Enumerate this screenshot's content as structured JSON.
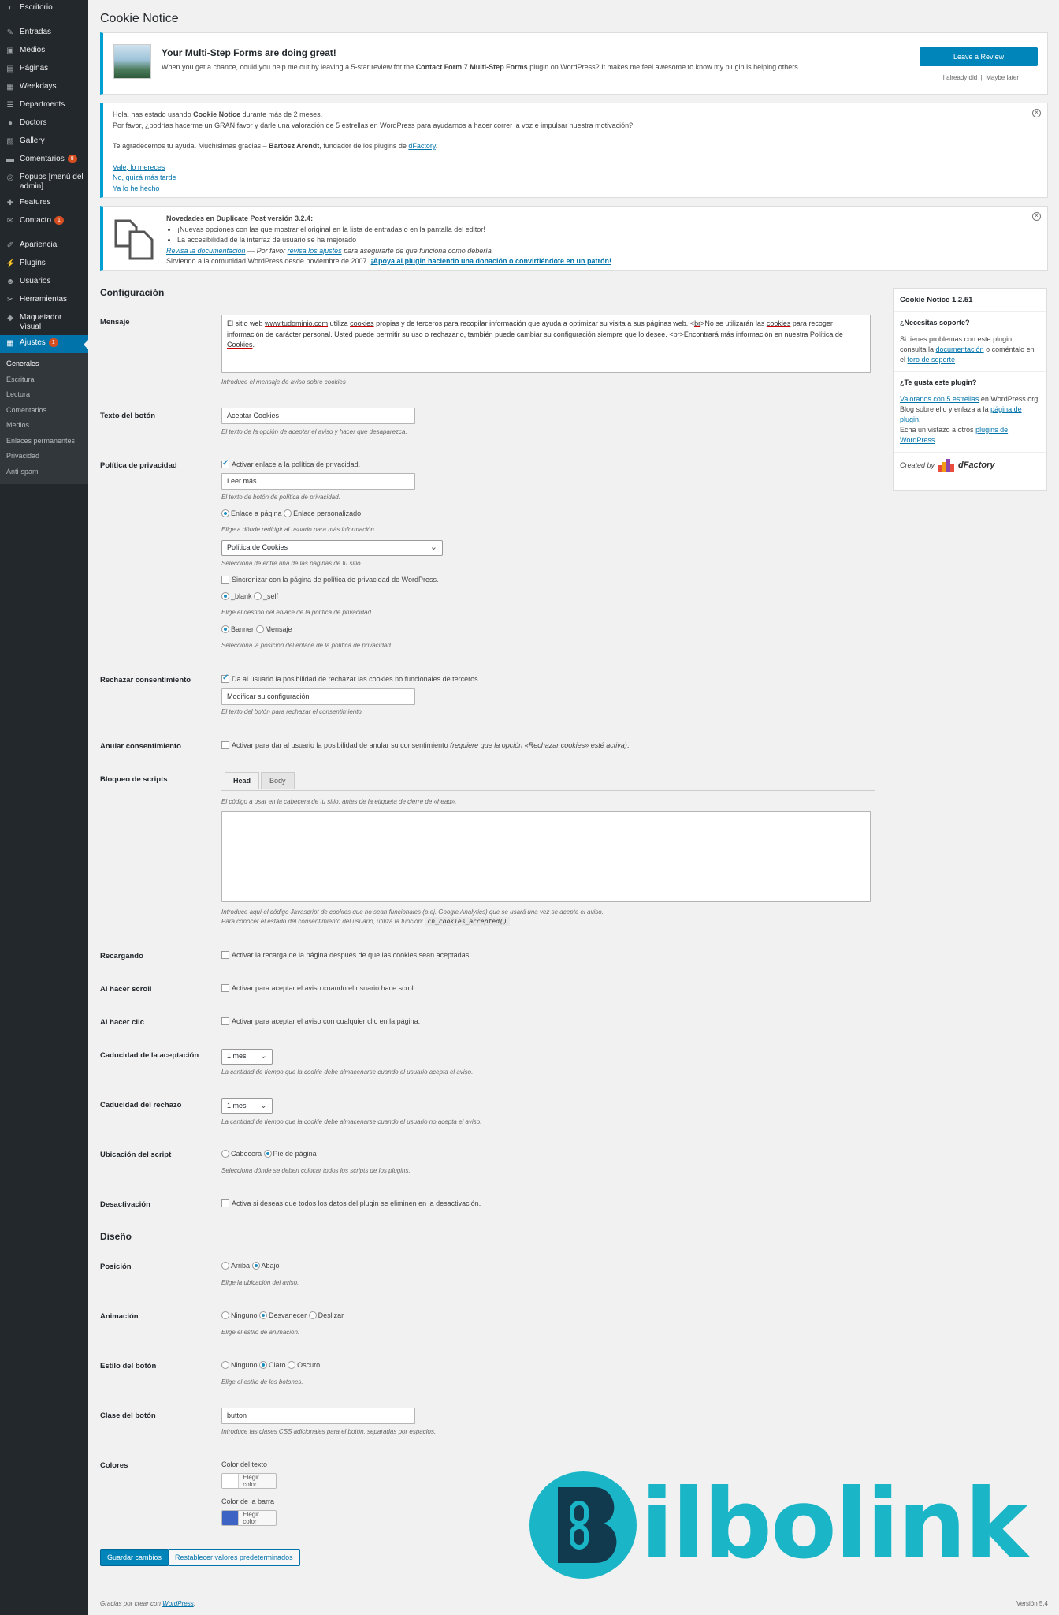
{
  "sidebar": {
    "items": [
      {
        "label": "Escritorio",
        "icon": "dashboard-icon"
      },
      {
        "label": "Entradas",
        "icon": "pin-icon"
      },
      {
        "label": "Medios",
        "icon": "media-icon"
      },
      {
        "label": "Páginas",
        "icon": "pages-icon"
      },
      {
        "label": "Weekdays",
        "icon": "calendar-icon"
      },
      {
        "label": "Departments",
        "icon": "list-icon"
      },
      {
        "label": "Doctors",
        "icon": "user-icon"
      },
      {
        "label": "Gallery",
        "icon": "gallery-icon"
      },
      {
        "label": "Comentarios",
        "icon": "comment-icon",
        "badge": "8"
      },
      {
        "label": "Popups [menú del admin]",
        "icon": "popup-icon"
      },
      {
        "label": "Features",
        "icon": "features-icon"
      },
      {
        "label": "Contacto",
        "icon": "mail-icon",
        "badge": "1"
      },
      {
        "label": "Apariencia",
        "icon": "brush-icon"
      },
      {
        "label": "Plugins",
        "icon": "plugin-icon"
      },
      {
        "label": "Usuarios",
        "icon": "users-icon"
      },
      {
        "label": "Herramientas",
        "icon": "wrench-icon"
      },
      {
        "label": "Maquetador Visual",
        "icon": "divi-icon"
      },
      {
        "label": "Ajustes",
        "icon": "settings-icon",
        "badge": "1"
      }
    ],
    "submenu": [
      "Generales",
      "Escritura",
      "Lectura",
      "Comentarios",
      "Medios",
      "Enlaces permanentes",
      "Privacidad",
      "Anti-spam"
    ]
  },
  "page_title": "Cookie Notice",
  "notice1": {
    "title": "Your Multi-Step Forms are doing great!",
    "text_a": "When you get a chance, could you help me out by leaving a 5-star review for the ",
    "text_b": "Contact Form 7 Multi-Step Forms",
    "text_c": " plugin on WordPress? It makes me feel awesome to know my plugin is helping others.",
    "button": "Leave a Review",
    "link1": "I already did",
    "divider": "|",
    "link2": "Maybe later"
  },
  "notice2": {
    "l1a": "Hola, has estado usando ",
    "l1b": "Cookie Notice",
    "l1c": " durante más de 2 meses.",
    "l2": "Por favor, ¿podrías hacerme un GRAN favor y darle una valoración de 5 estrellas en WordPress para ayudarnos a hacer correr la voz e impulsar nuestra motivación?",
    "l3a": "Te agradecemos tu ayuda. Muchísimas gracias – ",
    "l3b": "Bartosz Arendt",
    "l3c": ", fundador de los plugins de ",
    "l3d": "dFactory",
    "l3e": ".",
    "links": [
      "Vale, lo mereces",
      "No, quizá más tarde",
      "Ya lo he hecho"
    ]
  },
  "notice3": {
    "title": "Novedades en Duplicate Post versión 3.2.4:",
    "bullets": [
      "¡Nuevas opciones con las que mostrar el original en la lista de entradas o en la pantalla del editor!",
      "La accesibilidad de la interfaz de usuario se ha mejorado"
    ],
    "l3a": "Revisa la documentación",
    "l3b": " — Por favor ",
    "l3c": "revisa los ajustes",
    "l3d": " para asegurarte de que funciona como debería.",
    "l4a": "Sirviendo a la comunidad WordPress desde noviembre de 2007. ",
    "l4b": "¡Apoya al plugin haciendo una donación o convirtiéndote en un patrón!"
  },
  "config": {
    "heading": "Configuración",
    "mensaje": {
      "label": "Mensaje",
      "t1": "El sitio web ",
      "t2": "www.tudominio.com",
      "t3": " utiliza ",
      "t4": "cookies",
      "t5": " propias y de terceros para recopilar información que ayuda a optimizar su visita a sus páginas web. <",
      "t6": "br",
      "t7": ">No se utilizarán las ",
      "t8": "cookies",
      "t9": " para recoger información de carácter personal. Usted puede permitir su uso o rechazarlo, también puede cambiar su configuración siempre que lo desee. <",
      "t10": "br",
      "t11": ">Encontrará más información en nuestra Política de ",
      "t12": "Cookies",
      "t13": ".",
      "desc": "Introduce el mensaje de aviso sobre cookies"
    },
    "boton": {
      "label": "Texto del botón",
      "value": "Aceptar Cookies",
      "desc": "El texto de la opción de aceptar el aviso y hacer que desaparezca."
    },
    "privacidad": {
      "label": "Política de privacidad",
      "check": "Activar enlace a la política de privacidad.",
      "value": "Leer más",
      "desc1": "El texto de botón de política de privacidad.",
      "r1a": "Enlace a página",
      "r1b": "Enlace personalizado",
      "desc2": "Elige a dónde redirigir al usuario para más información.",
      "select": "Política de Cookies",
      "desc3": "Selecciona de entre una de las páginas de tu sitio",
      "sync": "Sincronizar con la página de política de privacidad de WordPress.",
      "r2a": "_blank",
      "r2b": "_self",
      "desc4": "Elige el destino del enlace de la política de privacidad.",
      "r3a": "Banner",
      "r3b": "Mensaje",
      "desc5": "Selecciona la posición del enlace de la política de privacidad."
    },
    "rechazar": {
      "label": "Rechazar consentimiento",
      "check": "Da al usuario la posibilidad de rechazar las cookies no funcionales de terceros.",
      "value": "Modificar su configuración",
      "desc": "El texto del botón para rechazar el consentimiento."
    },
    "anular": {
      "label": "Anular consentimiento",
      "check": "Activar para dar al usuario la posibilidad de anular su consentimiento ",
      "check_em": "(requiere que la opción «Rechazar cookies» esté activa)",
      "check_end": "."
    },
    "bloqueo": {
      "label": "Bloqueo de scripts",
      "tab1": "Head",
      "tab2": "Body",
      "desc1": "El código a usar en la cabecera de tu sitio, antes de la etiqueta de cierre de «head».",
      "desc2": "Introduce aquí el código Javascript de cookies que no sean funcionales (p.ej. Google Analytics) que se usará una vez se acepte el aviso.",
      "desc3": "Para conocer el estado del consentimiento del usuario, utiliza la función: ",
      "code": "cn_cookies_accepted()"
    },
    "recargando": {
      "label": "Recargando",
      "check": "Activar la recarga de la página después de que las cookies sean aceptadas."
    },
    "scroll": {
      "label": "Al hacer scroll",
      "check": "Activar para aceptar el aviso cuando el usuario hace scroll."
    },
    "clic": {
      "label": "Al hacer clic",
      "check": "Activar para aceptar el aviso con cualquier clic en la página."
    },
    "caducidad_acept": {
      "label": "Caducidad de la aceptación",
      "value": "1 mes",
      "desc": "La cantidad de tiempo que la cookie debe almacenarse cuando el usuario acepta el aviso."
    },
    "caducidad_rech": {
      "label": "Caducidad del rechazo",
      "value": "1 mes",
      "desc": "La cantidad de tiempo que la cookie debe almacenarse cuando el usuario no acepta el aviso."
    },
    "ubicacion": {
      "label": "Ubicación del script",
      "r1": "Cabecera",
      "r2": "Pie de página",
      "desc": "Selecciona dónde se deben colocar todos los scripts de los plugins."
    },
    "desactivacion": {
      "label": "Desactivación",
      "check": "Activa si deseas que todos los datos del plugin se eliminen en la desactivación."
    }
  },
  "diseno": {
    "heading": "Diseño",
    "posicion": {
      "label": "Posición",
      "r1": "Arriba",
      "r2": "Abajo",
      "desc": "Elige la ubicación del aviso."
    },
    "animacion": {
      "label": "Animación",
      "r1": "Ninguno",
      "r2": "Desvanecer",
      "r3": "Deslizar",
      "desc": "Elige el estilo de animación."
    },
    "estilo": {
      "label": "Estilo del botón",
      "r1": "Ninguno",
      "r2": "Claro",
      "r3": "Oscuro",
      "desc": "Elige el estilo de los botones."
    },
    "clase": {
      "label": "Clase del botón",
      "value": "button",
      "desc": "Introduce las clases CSS adicionales para el botón, separadas por espacios."
    },
    "colores": {
      "label": "Colores",
      "text_label": "Color del texto",
      "bar_label": "Color de la barra",
      "pick": "Elegir color",
      "text_color": "#ffffff",
      "bar_color": "#3d64c4"
    }
  },
  "buttons": {
    "save": "Guardar cambios",
    "reset": "Restablecer valores predeterminados"
  },
  "sidebox": {
    "title": "Cookie Notice 1.2.51",
    "support_h": "¿Necesitas soporte?",
    "support_a": "Si tienes problemas con este plugin, consulta la ",
    "support_b": "documentación",
    "support_c": " o coméntalo en el ",
    "support_d": "foro de soporte",
    "like_h": "¿Te gusta este plugin?",
    "like_a": "Valóranos con 5 estrellas",
    "like_b": " en WordPress.org",
    "like_c": "Blog sobre ello y enlaza a la ",
    "like_d": "página de plugin",
    "like_e": ".",
    "like_f": "Echa un vistazo a otros ",
    "like_g": "plugins de WordPress",
    "like_h2": ".",
    "created": "Created by",
    "brand": "dFactory"
  },
  "footer": {
    "thanks": "Gracias por crear con ",
    "wp": "WordPress",
    "dot": ".",
    "version": "Versión 5.4"
  },
  "watermark": {
    "text": "ilbolink",
    "color": "#1ab5c6"
  }
}
